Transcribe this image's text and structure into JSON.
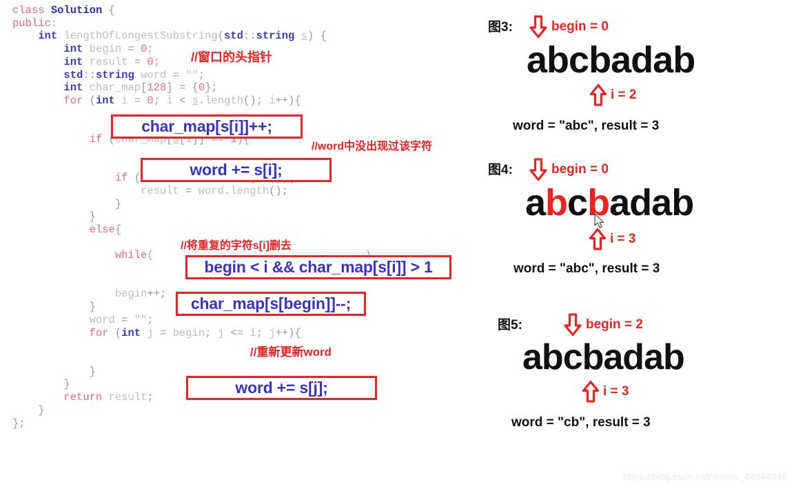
{
  "code": {
    "language": "cpp",
    "lines": [
      "class Solution {",
      "public:",
      "    int lengthOfLongestSubstring(std::string s) {",
      "        int begin = 0;",
      "        int result = 0;",
      "        std::string word = \"\";",
      "        int char_map[128] = {0};",
      "        for (int i = 0; i < s.length(); i++){",
      "            char_map[s[i]]++;",
      "            if (char_map[s[i]] == 1){",
      "                word += s[i];",
      "                if (result < word.length()){",
      "                    result = word.length();",
      "                }",
      "            }",
      "            else{",
      "                while(begin < i && char_map[s[i]] > 1){",
      "                    char_map[s[begin]]--;",
      "                    begin++;",
      "                }",
      "                word = \"\";",
      "                for (int j = begin; j <= i; j++){",
      "                    word += s[j];",
      "                }",
      "            }",
      "        }",
      "        return result;",
      "    }",
      "};"
    ]
  },
  "highlights": [
    {
      "id": "highlight-char-map-increment",
      "text": "char_map[s[i]]++;"
    },
    {
      "id": "highlight-word-append-i",
      "text": "word += s[i];"
    },
    {
      "id": "highlight-while-condition",
      "text": "begin < i && char_map[s[i]] > 1"
    },
    {
      "id": "highlight-char-map-decrement",
      "text": "char_map[s[begin]]--;"
    },
    {
      "id": "highlight-word-append-j",
      "text": "word += s[j];"
    }
  ],
  "annotations": [
    {
      "id": "note-window-head-pointer",
      "text": "//窗口的头指针"
    },
    {
      "id": "note-char-not-in-word",
      "text": "//word中没出现过该字符"
    },
    {
      "id": "note-remove-duplicate",
      "text": "//将重复的字符s[i]删去"
    },
    {
      "id": "note-rebuild-word",
      "text": "//重新更新word"
    }
  ],
  "figures": [
    {
      "label": "图3:",
      "begin_text": "begin = 0",
      "i_text": "i = 2",
      "string": "abcbadab",
      "red_indices": [],
      "summary": "word = \"abc\", result = 3",
      "begin_index": 0,
      "i_index": 2
    },
    {
      "label": "图4:",
      "begin_text": "begin = 0",
      "i_text": "i = 3",
      "string": "abcbadab",
      "red_indices": [
        1,
        3
      ],
      "summary": "word = \"abc\", result = 3",
      "begin_index": 0,
      "i_index": 3
    },
    {
      "label": "图5:",
      "begin_text": "begin = 2",
      "i_text": "i = 3",
      "string": "abcbadab",
      "red_indices": [],
      "summary": "word = \"cb\", result = 3",
      "begin_index": 2,
      "i_index": 3
    }
  ],
  "icons": {
    "down_arrow": "arrow-down-icon",
    "up_arrow": "arrow-up-icon",
    "cursor": "mouse-cursor-icon"
  },
  "colors": {
    "accent_red": "#ee2222",
    "highlight_blue": "#3b32c4",
    "code_keyword": "#e36a7a",
    "code_type": "#3b3bbd",
    "code_identifier": "#bdbdbd"
  },
  "watermark": "https://blog.csdn.net/weixin_44944046"
}
